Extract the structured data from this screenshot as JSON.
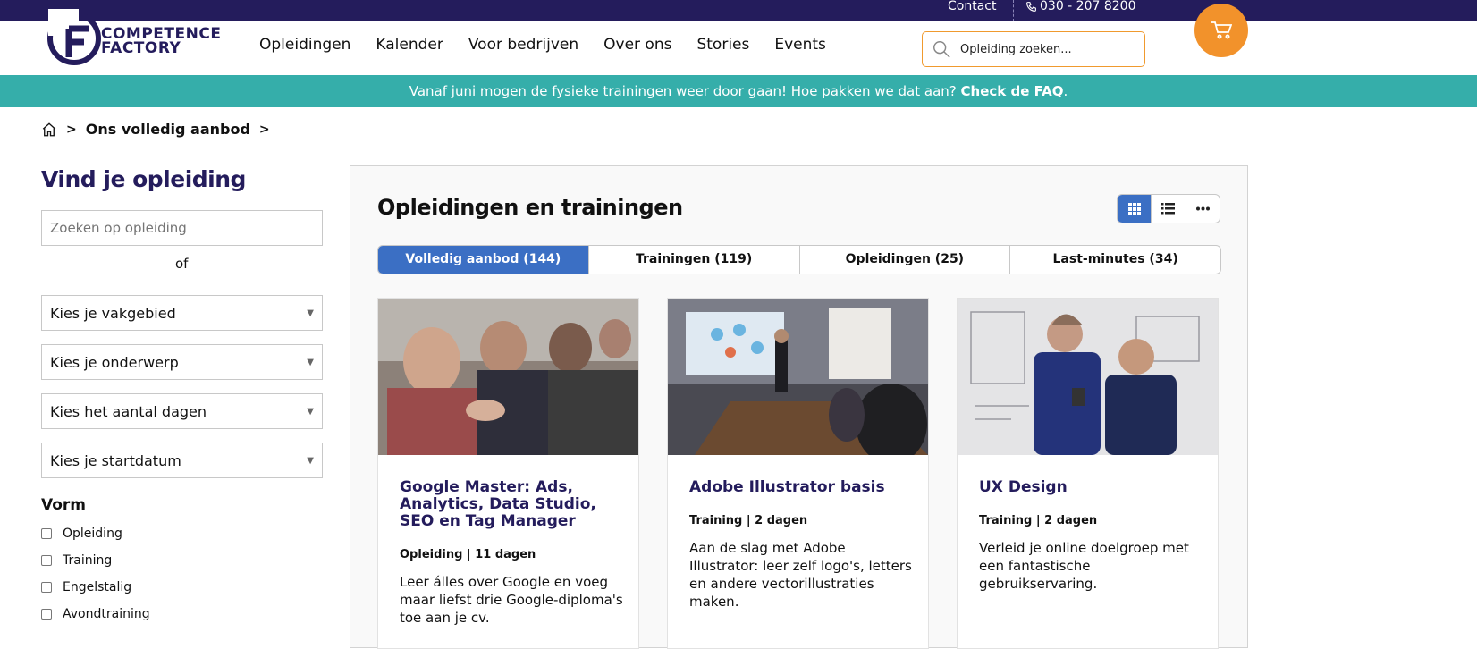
{
  "topbar": {
    "contact": "Contact",
    "phone": "030 - 207 8200"
  },
  "brand": {
    "line1": "COMPETENCE",
    "line2": "FACTORY"
  },
  "nav": [
    "Opleidingen",
    "Kalender",
    "Voor bedrijven",
    "Over ons",
    "Stories",
    "Events"
  ],
  "search": {
    "placeholder": "Opleiding zoeken..."
  },
  "banner": {
    "text": "Vanaf juni mogen de fysieke trainingen weer door gaan! Hoe pakken we dat aan? ",
    "link": "Check de FAQ",
    "end": "."
  },
  "breadcrumb": {
    "current": "Ons volledig aanbod"
  },
  "sidebar": {
    "title": "Vind je opleiding",
    "search_placeholder": "Zoeken op opleiding",
    "or": "of",
    "selects": [
      "Kies je vakgebied",
      "Kies je onderwerp",
      "Kies het aantal dagen",
      "Kies je startdatum"
    ],
    "vorm_title": "Vorm",
    "vorm_options": [
      "Opleiding",
      "Training",
      "Engelstalig",
      "Avondtraining"
    ]
  },
  "main": {
    "title": "Opleidingen en trainingen",
    "tabs": [
      "Volledig aanbod (144)",
      "Trainingen (119)",
      "Opleidingen (25)",
      "Last-minutes (34)"
    ],
    "cards": [
      {
        "title": "Google Master: Ads, Analytics, Data Studio, SEO en Tag Manager",
        "meta": "Opleiding | 11 dagen",
        "desc": "Leer álles over Google en voeg maar liefst drie Google-diploma's toe aan je cv."
      },
      {
        "title": "Adobe Illustrator basis",
        "meta": "Training | 2 dagen",
        "desc": "Aan de slag met Adobe Illustrator: leer zelf logo's, letters en andere vectorillustraties maken."
      },
      {
        "title": "UX Design",
        "meta": "Training | 2 dagen",
        "desc": "Verleid je online doelgroep met een fantastische gebruikservaring."
      }
    ]
  },
  "colors": {
    "navy": "#241c5c",
    "teal": "#35aeaa",
    "orange": "#f2922b",
    "blue": "#3b6fc4"
  }
}
